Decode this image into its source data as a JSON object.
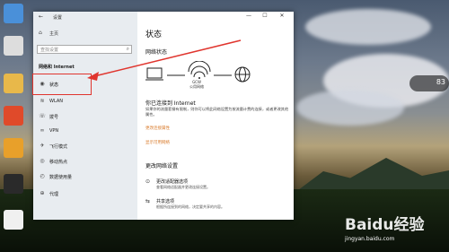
{
  "window": {
    "title": "设置",
    "controls": [
      "—",
      "☐",
      "✕"
    ]
  },
  "sidebar": {
    "home_label": "主页",
    "search_placeholder": "查找设置",
    "section_heading": "网络和 Internet",
    "items": [
      {
        "label": "状态",
        "icon": "home-network-icon",
        "active": true
      },
      {
        "label": "WLAN",
        "icon": "wifi-icon"
      },
      {
        "label": "拨号",
        "icon": "phone-icon"
      },
      {
        "label": "VPN",
        "icon": "vpn-icon"
      },
      {
        "label": "飞行模式",
        "icon": "airplane-icon"
      },
      {
        "label": "移动热点",
        "icon": "hotspot-icon"
      },
      {
        "label": "数据使用量",
        "icon": "data-usage-icon"
      },
      {
        "label": "代理",
        "icon": "globe-icon"
      }
    ]
  },
  "content": {
    "title": "状态",
    "network_status_heading": "网络状态",
    "network_name": "GCW",
    "network_type": "公用网络",
    "connected_heading": "你已连接到 Internet",
    "connected_desc": "如果你的流量套餐有限制，则你可以将此网络设置为按流量计费的连接，或者更改其他属性。",
    "link_change_properties": "更改连接属性",
    "link_show_networks": "显示可用网络",
    "change_settings_heading": "更改网络设置",
    "options": [
      {
        "title": "更改适配器选项",
        "desc": "查看网络适配器并更改连接设置。",
        "icon": "adapter-icon"
      },
      {
        "title": "共享选项",
        "desc": "根据所连接到的网络，决定要共享的内容。",
        "icon": "share-icon"
      }
    ]
  },
  "widget": {
    "value": "83",
    "label": "%"
  },
  "watermark": {
    "brand": "Baidu经验",
    "url": "jingyan.baidu.com"
  },
  "colors": {
    "highlight": "#e0352e",
    "link": "#d97a2a"
  }
}
